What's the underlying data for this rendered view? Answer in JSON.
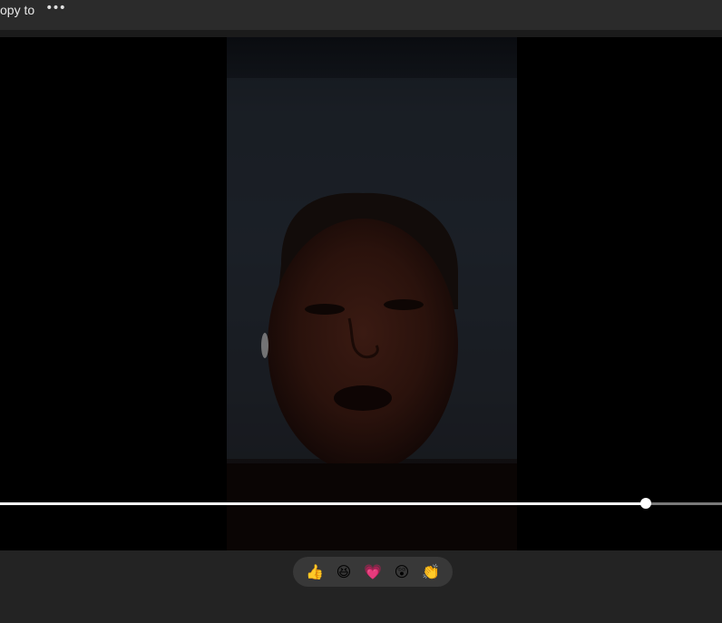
{
  "toolbar": {
    "copy_label": "opy to",
    "more_label": "•••"
  },
  "video": {
    "playback_progress": 0.895
  },
  "reactions": [
    {
      "icon": "thumbs-up-icon",
      "glyph": "👍"
    },
    {
      "icon": "laughing-icon",
      "glyph": "😆"
    },
    {
      "icon": "heart-icon",
      "glyph": "💗"
    },
    {
      "icon": "surprised-icon",
      "glyph": "😲"
    },
    {
      "icon": "clapping-icon",
      "glyph": "👏"
    }
  ],
  "colors": {
    "background": "#232323",
    "topbar": "#2b2b2b",
    "video_bg": "#000000",
    "seek_played": "#ffffff",
    "seek_remaining": "#7a7a7a",
    "reaction_tray": "#383838"
  }
}
